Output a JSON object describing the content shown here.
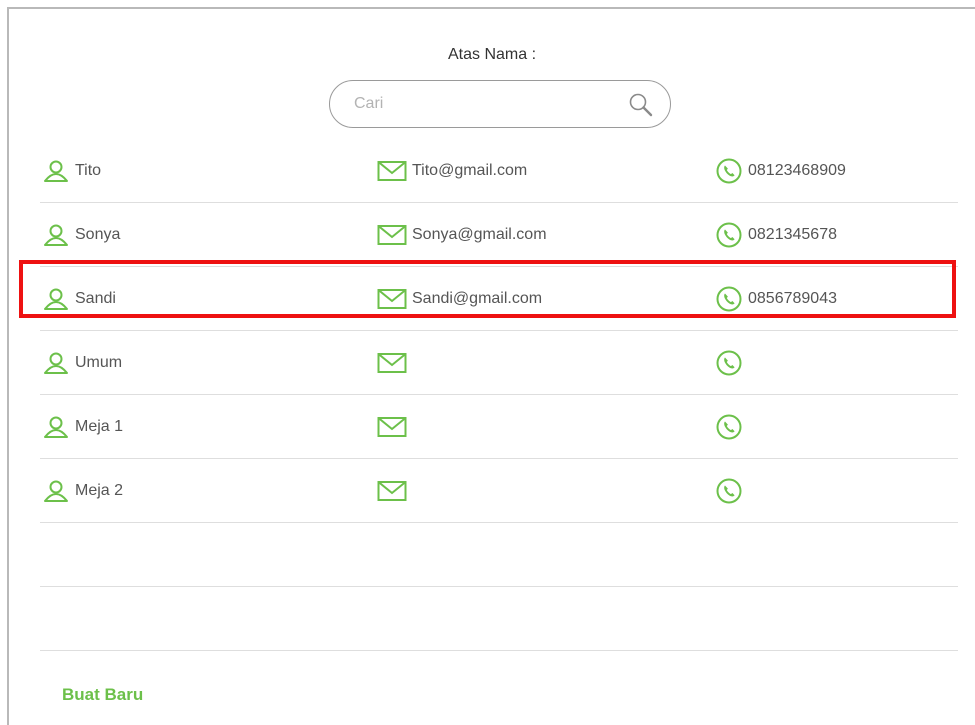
{
  "header": {
    "title": "Atas Nama :"
  },
  "search": {
    "placeholder": "Cari",
    "value": ""
  },
  "colors": {
    "accent": "#6cc04a",
    "highlight": "#ee1111",
    "divider": "#dedede"
  },
  "icons": {
    "person": "user-icon",
    "email": "mail-icon",
    "phone": "phone-icon",
    "search": "search-icon"
  },
  "contacts": [
    {
      "name": "Tito",
      "email": "Tito@gmail.com",
      "phone": "08123468909"
    },
    {
      "name": "Sonya",
      "email": "Sonya@gmail.com",
      "phone": "0821345678"
    },
    {
      "name": "Sandi",
      "email": "Sandi@gmail.com",
      "phone": "0856789043",
      "highlighted": true
    },
    {
      "name": "Umum",
      "email": "",
      "phone": ""
    },
    {
      "name": "Meja 1",
      "email": "",
      "phone": ""
    },
    {
      "name": "Meja 2",
      "email": "",
      "phone": ""
    }
  ],
  "actions": {
    "new_label": "Buat Baru"
  }
}
